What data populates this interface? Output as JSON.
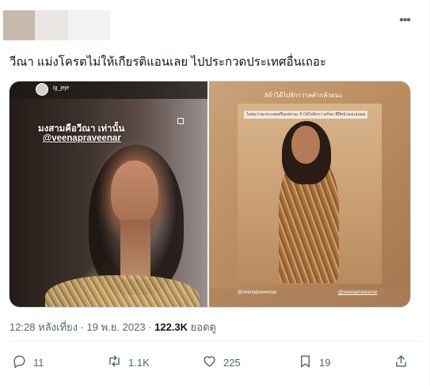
{
  "post": {
    "text": "วีณา แม่งโครตไม่ให้เกียรติแอนเลย ไปประกวดประเทศอื่นเถอะ",
    "more_icon": "more-horizontal-icon"
  },
  "media": {
    "left_image": {
      "handle": "ig_jeje",
      "caption_line1": "มงสามคือวีณา เท่านั้น",
      "caption_line2": "@veenapraveenar"
    },
    "right_image": {
      "hashtag": "#ถ้าได้ไปจักรวาลคำกล้วยนะ",
      "subcaption": "ไม่สนว่าจะกระเทยหรือเปล่านะ ถ้าได้ไปจักรวาลก็จบ ที่ปีหน้ามงแน่นอน",
      "footer_left": "@veenapraveenar",
      "footer_right": "@veenapraveenar"
    }
  },
  "meta": {
    "time_date": "12:28 หลังเที่ยง · 19 พ.ย. 2023 · ",
    "views": "122.3K",
    "views_label": " ยอดดู"
  },
  "actions": {
    "reply": {
      "count": "11",
      "icon": "reply-icon"
    },
    "retweet": {
      "count": "1.1K",
      "icon": "retweet-icon"
    },
    "like": {
      "count": "225",
      "icon": "heart-icon"
    },
    "bookmark": {
      "count": "19",
      "icon": "bookmark-icon"
    },
    "share": {
      "icon": "share-icon"
    }
  },
  "colors": {
    "text": "#0f1419",
    "secondary": "#536471",
    "border": "#cfd9de"
  }
}
